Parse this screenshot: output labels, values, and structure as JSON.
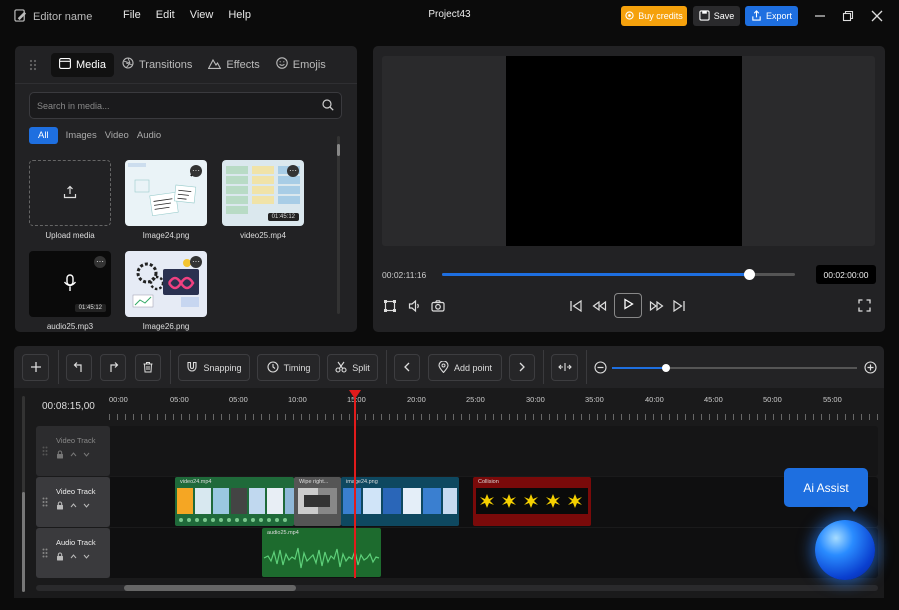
{
  "app": {
    "name": "Editor name",
    "menu": [
      "File",
      "Edit",
      "View",
      "Help"
    ],
    "project": "Project43",
    "buy_credits": "Buy credits",
    "save": "Save",
    "export": "Export"
  },
  "media_panel": {
    "tabs": [
      "Media",
      "Transitions",
      "Effects",
      "Emojis"
    ],
    "search_placeholder": "Search in media...",
    "filters": [
      "All",
      "Images",
      "Video",
      "Audio"
    ],
    "items": [
      {
        "label": "Upload media",
        "type": "upload"
      },
      {
        "label": "Image24.png",
        "type": "image"
      },
      {
        "label": "video25.mp4",
        "type": "video",
        "duration": "01:45:12"
      },
      {
        "label": "audio25.mp3",
        "type": "audio",
        "duration": "01:45:12"
      },
      {
        "label": "Image26.png",
        "type": "image"
      }
    ]
  },
  "preview": {
    "current_time": "00:02:11:16",
    "total_time": "00:02:00:00",
    "progress": 0.87
  },
  "toolbar": {
    "snapping": "Snapping",
    "timing": "Timing",
    "split": "Split",
    "add_point": "Add point",
    "zoom": 0.22
  },
  "timeline": {
    "timecode": "00:08:15,00",
    "ticks": [
      "00:00",
      "05:00",
      "05:00",
      "10:00",
      "15:00",
      "20:00",
      "25:00",
      "30:00",
      "35:00",
      "40:00",
      "45:00",
      "50:00",
      "55:00"
    ],
    "tracks": [
      "Video Track",
      "Video Track",
      "Audio Track"
    ],
    "clips": {
      "video": "video24.mp4",
      "transition": "Wipe right...",
      "image": "image24.png",
      "effect": "Collision",
      "audio": "audio25.mp4"
    },
    "ai_assist": "Ai Assist"
  },
  "colors": {
    "accent": "#1e6fe0",
    "buy": "#f5a10c",
    "effect_clip": "#7a0a0a",
    "audio_clip": "#1d6b2e"
  }
}
